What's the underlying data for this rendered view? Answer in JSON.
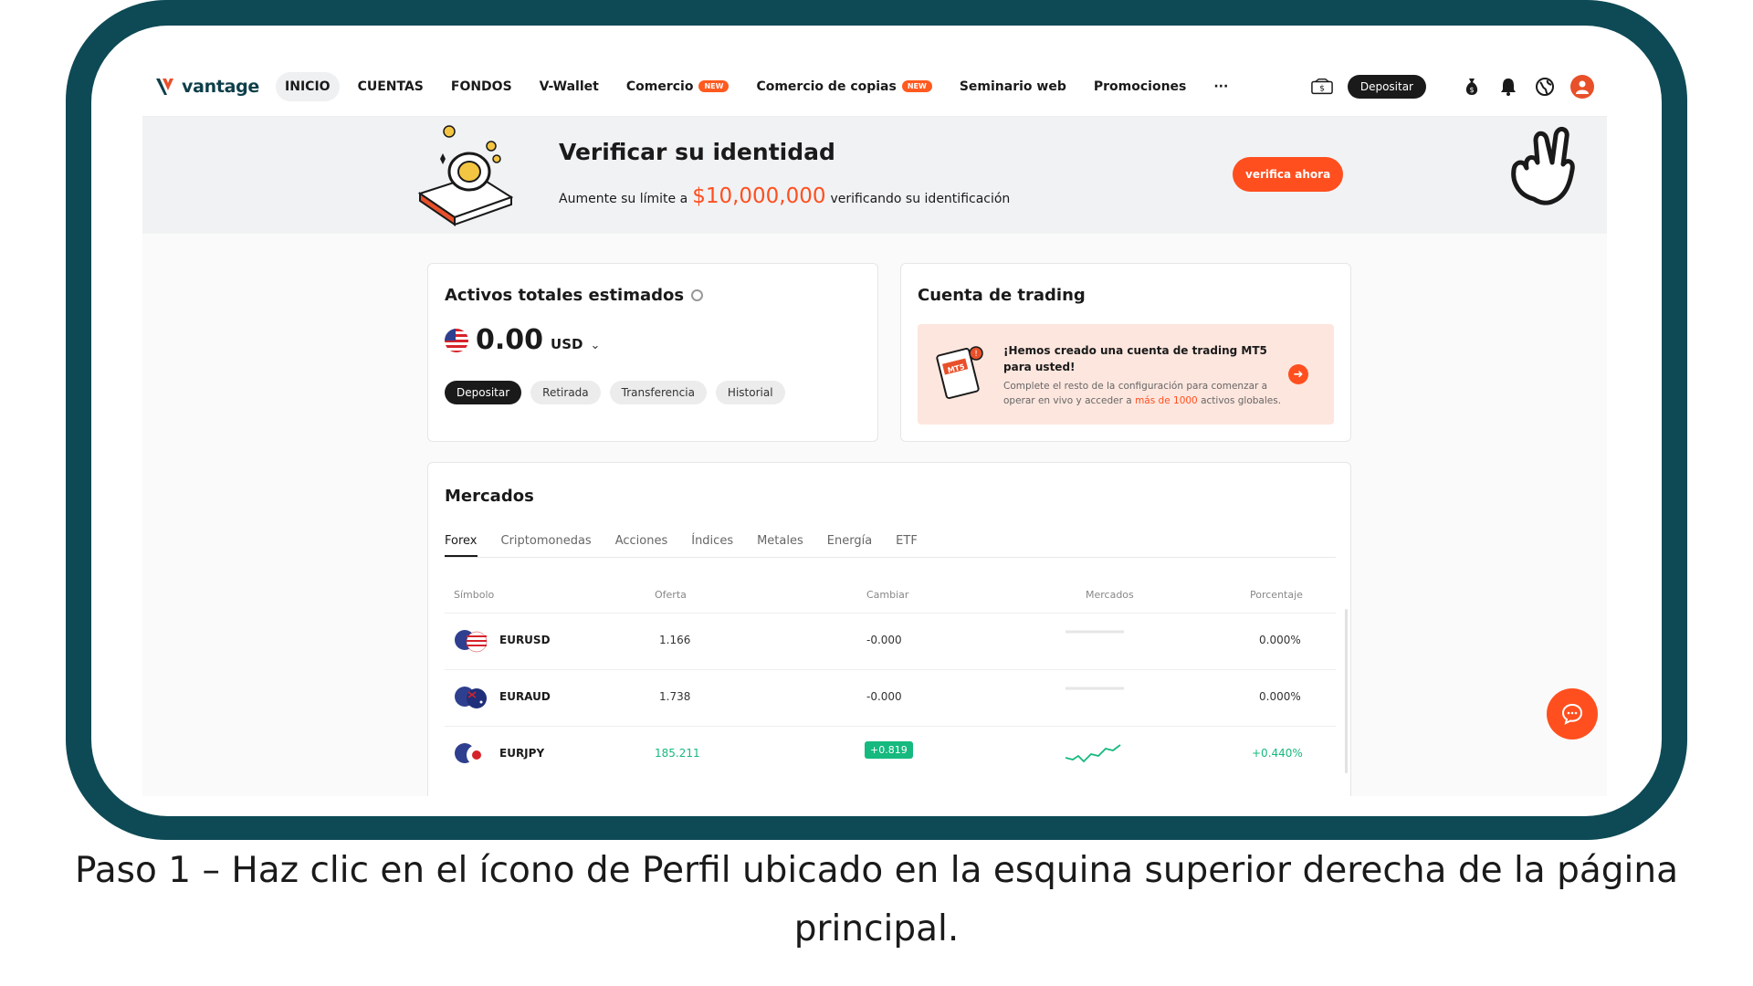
{
  "nav": {
    "logo_text": "vantage",
    "items": [
      {
        "label": "INICIO",
        "badge": ""
      },
      {
        "label": "CUENTAS",
        "badge": ""
      },
      {
        "label": "FONDOS",
        "badge": ""
      },
      {
        "label": "V-Wallet",
        "badge": ""
      },
      {
        "label": "Comercio",
        "badge": "NEW"
      },
      {
        "label": "Comercio de copias",
        "badge": "NEW"
      },
      {
        "label": "Seminario web",
        "badge": ""
      },
      {
        "label": "Promociones",
        "badge": ""
      }
    ],
    "more_label": "···",
    "deposit_label": "Depositar",
    "icons": [
      "cash-icon",
      "money-bag-icon",
      "bell-icon",
      "globe-icon",
      "profile-avatar"
    ]
  },
  "banner": {
    "title": "Verificar su identidad",
    "subtitle_pre": "Aumente su límite a",
    "amount": "$10,000,000",
    "subtitle_post": "verificando su identificación",
    "button": "verifica ahora"
  },
  "assets": {
    "title": "Activos totales estimados",
    "amount": "0.00",
    "currency": "USD",
    "buttons": [
      "Depositar",
      "Retirada",
      "Transferencia",
      "Historial"
    ]
  },
  "trading": {
    "title": "Cuenta de trading",
    "promo_head": "¡Hemos creado una cuenta de trading MT5 para usted!",
    "promo_body_pre": "Complete el resto de la configuración para comenzar a operar en vivo y acceder a",
    "promo_body_hl": "más de 1000",
    "promo_body_post": "activos globales."
  },
  "markets": {
    "title": "Mercados",
    "tabs": [
      "Forex",
      "Criptomonedas",
      "Acciones",
      "Índices",
      "Metales",
      "Energía",
      "ETF"
    ],
    "columns": [
      "Símbolo",
      "Oferta",
      "Cambiar",
      "Mercados",
      "Porcentaje"
    ],
    "rows": [
      {
        "symbol": "EURUSD",
        "bid": "1.166",
        "change": "-0.000",
        "percent": "0.000%",
        "trend": "flat"
      },
      {
        "symbol": "EURAUD",
        "bid": "1.738",
        "change": "-0.000",
        "percent": "0.000%",
        "trend": "flat"
      },
      {
        "symbol": "EURJPY",
        "bid": "185.211",
        "change": "+0.819",
        "percent": "+0.440%",
        "trend": "up"
      }
    ]
  },
  "caption": "Paso 1 – Haz clic en el ícono de Perfil ubicado en la esquina superior derecha de la página principal.",
  "colors": {
    "frame": "#0e4a55",
    "accent": "#ff4f1f",
    "positive": "#16b97e"
  }
}
